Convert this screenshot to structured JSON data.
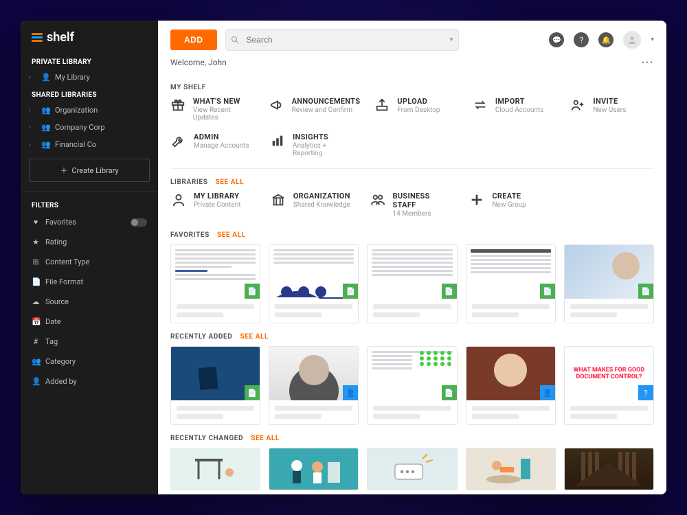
{
  "brand": "shelf",
  "sidebar": {
    "private_title": "PRIVATE LIBRARY",
    "private_items": [
      {
        "label": "My Library"
      }
    ],
    "shared_title": "SHARED LIBRARIES",
    "shared_items": [
      {
        "label": "Organization"
      },
      {
        "label": "Company Corp"
      },
      {
        "label": "Financial Co"
      }
    ],
    "create_library_label": "Create Library",
    "filters_title": "FILTERS",
    "filters": [
      {
        "label": "Favorites",
        "icon": "♥",
        "toggle": true
      },
      {
        "label": "Rating",
        "icon": "★"
      },
      {
        "label": "Content Type",
        "icon": "⊞"
      },
      {
        "label": "File Format",
        "icon": "📄"
      },
      {
        "label": "Source",
        "icon": "☁"
      },
      {
        "label": "Date",
        "icon": "📅"
      },
      {
        "label": "Tag",
        "icon": "#"
      },
      {
        "label": "Category",
        "icon": "👥"
      },
      {
        "label": "Added by",
        "icon": "👤"
      }
    ]
  },
  "topbar": {
    "add_label": "ADD",
    "search_placeholder": "Search"
  },
  "welcome": "Welcome, John",
  "sections": {
    "my_shelf": {
      "title": "MY SHELF",
      "row1": [
        {
          "title": "WHAT'S NEW",
          "sub": "View Recent Updates"
        },
        {
          "title": "ANNOUNCEMENTS",
          "sub": "Review and Confirm"
        },
        {
          "title": "UPLOAD",
          "sub": "From Desktop"
        },
        {
          "title": "IMPORT",
          "sub": "Cloud Accounts"
        },
        {
          "title": "INVITE",
          "sub": "New Users"
        }
      ],
      "row2": [
        {
          "title": "ADMIN",
          "sub": "Manage Accounts"
        },
        {
          "title": "INSIGHTS",
          "sub": "Analytics + Reporting"
        }
      ]
    },
    "libraries": {
      "title": "LIBRARIES",
      "see_all": "SEE ALL",
      "items": [
        {
          "title": "MY LIBRARY",
          "sub": "Private Content"
        },
        {
          "title": "ORGANIZATION",
          "sub": "Shared Knowledge"
        },
        {
          "title": "BUSINESS STAFF",
          "sub": "14 Members"
        },
        {
          "title": "CREATE",
          "sub": "New Group"
        }
      ]
    },
    "favorites": {
      "title": "FAVORITES",
      "see_all": "SEE ALL"
    },
    "recently_added": {
      "title": "RECENTLY ADDED",
      "see_all": "SEE ALL"
    },
    "recently_changed": {
      "title": "RECENTLY CHANGED",
      "see_all": "SEE ALL"
    },
    "doc_control_text": "WHAT MAKES FOR GOOD DOCUMENT CONTROL?"
  }
}
